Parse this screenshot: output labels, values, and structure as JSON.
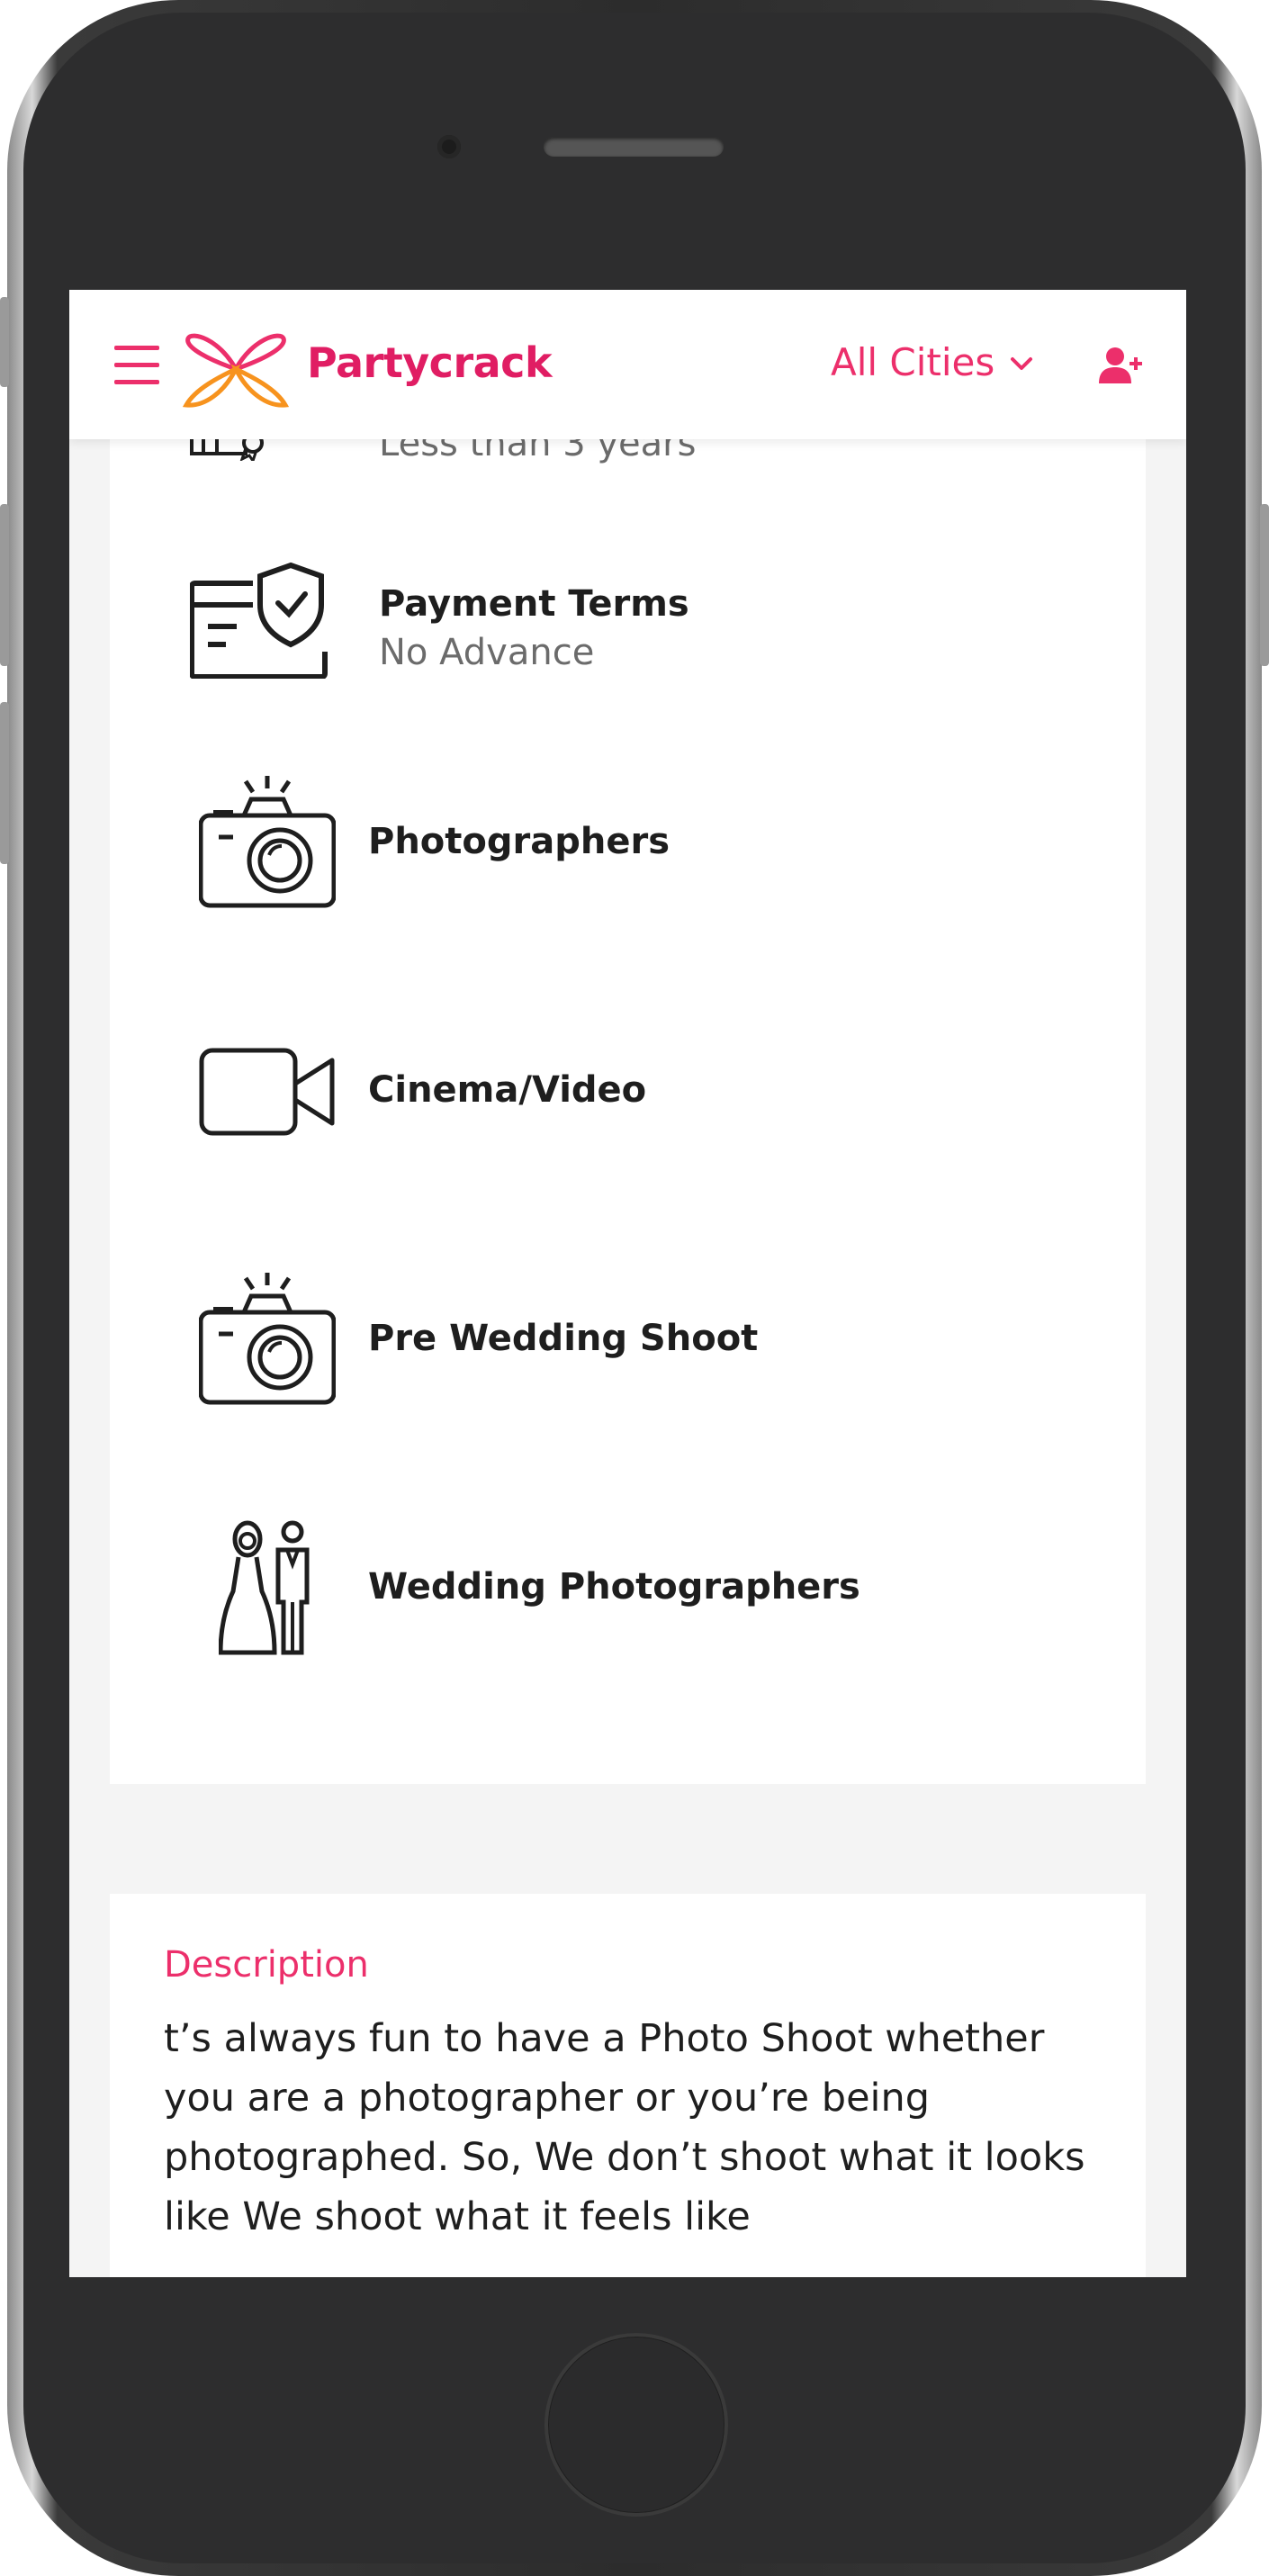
{
  "header": {
    "brand": "Partycrack",
    "city_selector": "All Cities",
    "icons": {
      "menu": "hamburger-icon",
      "logo": "butterfly-logo",
      "dropdown": "chevron-down-icon",
      "account": "add-user-icon"
    },
    "accent_color": "#ec2f6b"
  },
  "details": {
    "experience": {
      "value": "Less than 3 years",
      "icon": "award-certificate-icon"
    },
    "payment": {
      "label": "Payment Terms",
      "value": "No Advance",
      "icon": "payment-shield-icon"
    }
  },
  "services": [
    {
      "label": "Photographers",
      "icon": "camera-flash-icon"
    },
    {
      "label": "Cinema/Video",
      "icon": "video-camera-icon"
    },
    {
      "label": "Pre Wedding Shoot",
      "icon": "camera-flash-icon"
    },
    {
      "label": "Wedding Photographers",
      "icon": "bride-groom-icon"
    }
  ],
  "description": {
    "title": "Description",
    "body": "t’s always fun to have a Photo Shoot whether you are a photographer or you’re being photographed. So, We don’t shoot what it looks like We shoot what it feels like"
  }
}
